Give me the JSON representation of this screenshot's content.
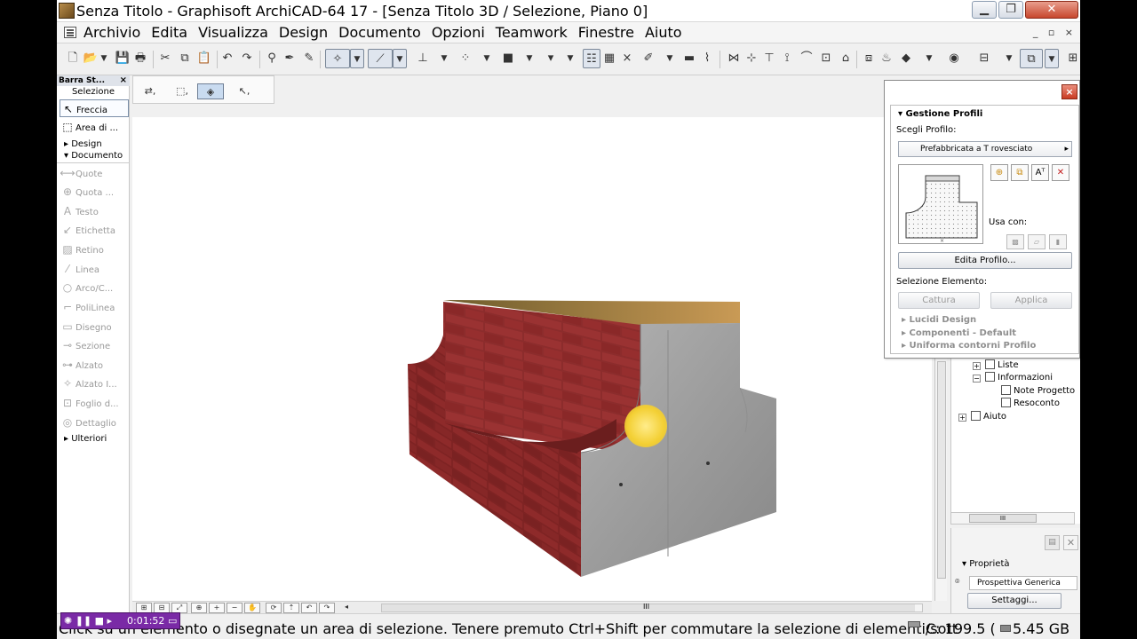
{
  "window": {
    "title": "Senza Titolo - Graphisoft ArchiCAD-64 17 - [Senza Titolo 3D / Selezione, Piano 0]",
    "controls": [
      "▁",
      "❐",
      "✕"
    ]
  },
  "menu": {
    "items": [
      "Archivio",
      "Edita",
      "Visualizza",
      "Design",
      "Documento",
      "Opzioni",
      "Teamwork",
      "Finestre",
      "Aiuto"
    ],
    "mdi_controls": "_ ▫ ×"
  },
  "toolbox": {
    "header": "Barra St...",
    "close": "×",
    "selection_title": "Selezione",
    "arrow": "Freccia",
    "marquee": "Area di ...",
    "group_design": "Design",
    "group_document": "Documento",
    "document_tools": [
      "Quote",
      "Quota ...",
      "Testo",
      "Etichetta",
      "Retino",
      "Linea",
      "Arco/C...",
      "PoliLinea",
      "Disegno",
      "Sezione",
      "Alzato",
      "Alzato I...",
      "Foglio d...",
      "Dettaglio"
    ],
    "group_more": "Ulteriori"
  },
  "profile_manager": {
    "close": "×",
    "section": "Gestione Profili",
    "choose_label": "Scegli Profilo:",
    "selected_profile": "Prefabbricata a T rovesciato",
    "use_with": "Usa con:",
    "edit_button": "Edita Profilo...",
    "selection_label": "Selezione Elemento:",
    "capture_button": "Cattura",
    "apply_button": "Applica",
    "expanders": [
      "Lucidi Design",
      "Componenti - Default",
      "Uniforma contorni Profilo"
    ]
  },
  "navigator": {
    "items": [
      "Liste",
      "Informazioni",
      "Note Progetto",
      "Resoconto",
      "Aiuto"
    ],
    "scroll_thumb": "III"
  },
  "properties": {
    "title": "Proprietà",
    "view_name": "Prospettiva Generica",
    "settings_button": "Settaggi..."
  },
  "status": {
    "message": "Click su un elemento o disegnate un area di selezione. Tenere premuto Ctrl+Shift per commutare la selezione di elementi/sott",
    "coord": "C: 199.5 (",
    "disk": "5.45 GB"
  },
  "recorder": {
    "time": "0:01:52"
  },
  "bottom_scroll_thumb": "III",
  "colors": {
    "brick": "#8a2a2a",
    "concrete": "#9b9b9b",
    "wood_top": "#b08442",
    "cursor_highlight": "#f3cf33"
  }
}
